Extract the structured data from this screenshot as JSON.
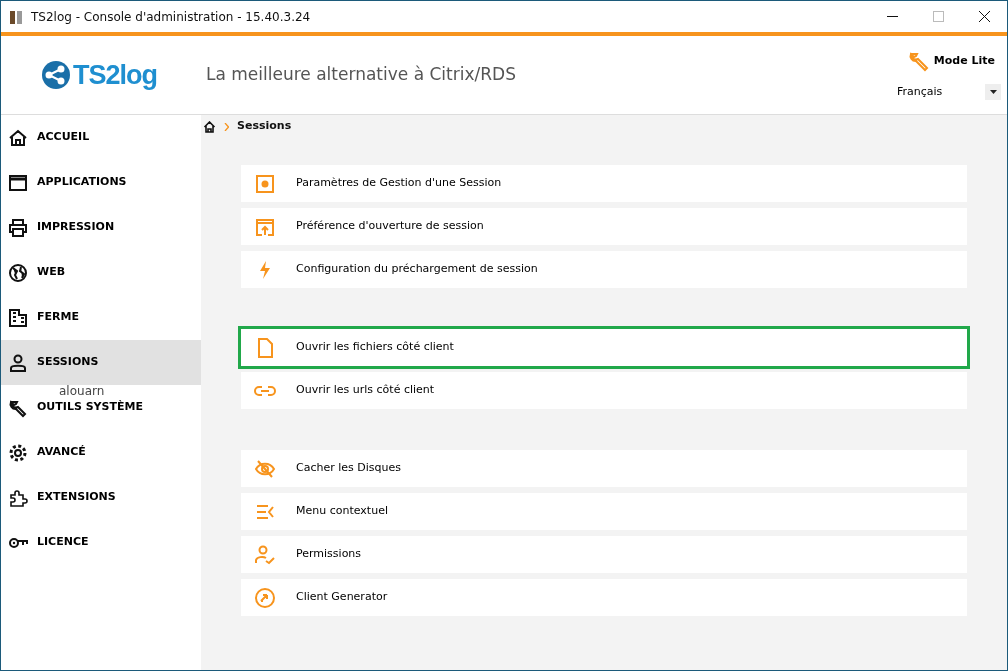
{
  "window": {
    "title": "TS2log - Console d'administration - 15.40.3.24"
  },
  "header": {
    "logo": "TS2log",
    "tagline": "La meilleure alternative à Citrix/RDS",
    "mode_button": "Mode Lite",
    "language": "Français"
  },
  "sidebar": {
    "items": [
      {
        "label": "ACCUEIL",
        "selected": false
      },
      {
        "label": "APPLICATIONS",
        "selected": false
      },
      {
        "label": "IMPRESSION",
        "selected": false
      },
      {
        "label": "WEB",
        "selected": false
      },
      {
        "label": "FERME",
        "selected": false
      },
      {
        "label": "SESSIONS",
        "selected": true
      },
      {
        "label": "OUTILS SYSTÈME",
        "selected": false
      },
      {
        "label": "AVANCÉ",
        "selected": false
      },
      {
        "label": "EXTENSIONS",
        "selected": false
      },
      {
        "label": "LICENCE",
        "selected": false
      }
    ]
  },
  "tooltip": "alouarn",
  "breadcrumb": {
    "current": "Sessions"
  },
  "groups": [
    {
      "items": [
        {
          "label": "Paramètres de Gestion d'une Session",
          "highlighted": false
        },
        {
          "label": "Préférence d'ouverture de session",
          "highlighted": false
        },
        {
          "label": "Configuration du préchargement de session",
          "highlighted": false
        }
      ]
    },
    {
      "items": [
        {
          "label": "Ouvrir les fichiers côté client",
          "highlighted": true
        },
        {
          "label": "Ouvrir les urls côté client",
          "highlighted": false
        }
      ]
    },
    {
      "items": [
        {
          "label": "Cacher les Disques",
          "highlighted": false
        },
        {
          "label": "Menu contextuel",
          "highlighted": false
        },
        {
          "label": "Permissions",
          "highlighted": false
        },
        {
          "label": "Client Generator",
          "highlighted": false
        }
      ]
    }
  ]
}
